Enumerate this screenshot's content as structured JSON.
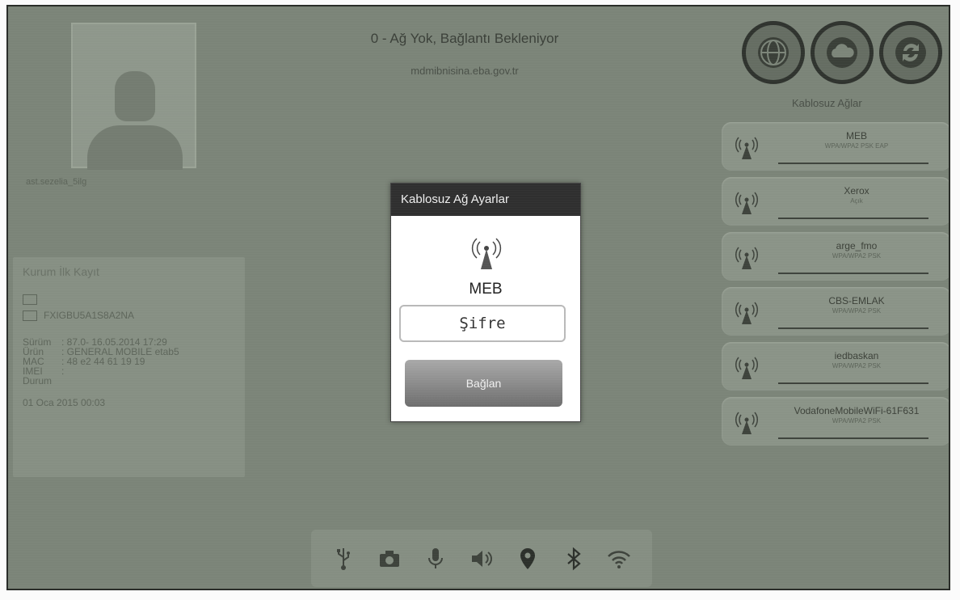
{
  "header": {
    "title": "0 - Ağ Yok, Bağlantı Bekleniyor",
    "subtitle": "mdmibnisina.eba.gov.tr"
  },
  "top_buttons": [
    {
      "icon": "globe-icon"
    },
    {
      "icon": "cloud-icon"
    },
    {
      "icon": "sync-icon"
    }
  ],
  "user": {
    "name": "ast.sezelia_5ilg"
  },
  "kurum_panel": {
    "title": "Kurum İlk Kayıt",
    "device_id": "FXIGBU5A1S8A2NA",
    "info": [
      {
        "key": "Sürüm",
        "value": ": 87.0- 16.05.2014 17:29"
      },
      {
        "key": "Ürün",
        "value": ": GENERAL MOBILE etab5"
      },
      {
        "key": "MAC",
        "value": ": 48 e2 44 61 19 19"
      },
      {
        "key": "IMEI",
        "value": ": "
      },
      {
        "key": "Durum",
        "value": ""
      }
    ],
    "date": "01 Oca 2015  00:03"
  },
  "wireless": {
    "label": "Kablosuz Ağlar",
    "networks": [
      {
        "name": "MEB",
        "security": "WPA/WPA2 PSK EAP"
      },
      {
        "name": "Xerox",
        "security": "Açık"
      },
      {
        "name": "arge_fmo",
        "security": "WPA/WPA2 PSK"
      },
      {
        "name": "CBS-EMLAK",
        "security": "WPA/WPA2 PSK"
      },
      {
        "name": "iedbaskan",
        "security": "WPA/WPA2 PSK"
      },
      {
        "name": "VodafoneMobileWiFi-61F631",
        "security": "WPA/WPA2 PSK"
      }
    ]
  },
  "dialog": {
    "title": "Kablosuz Ağ Ayarlar",
    "network_name": "MEB",
    "password_placeholder": "Şifre",
    "connect_label": "Bağlan"
  },
  "bottom_bar": [
    {
      "icon": "usb-icon"
    },
    {
      "icon": "camera-icon"
    },
    {
      "icon": "microphone-icon"
    },
    {
      "icon": "speaker-icon"
    },
    {
      "icon": "location-icon"
    },
    {
      "icon": "bluetooth-icon"
    },
    {
      "icon": "wifi-icon"
    }
  ],
  "colors": {
    "screen_bg": "#7b8478",
    "dialog_header": "#2f2f2f",
    "connect_button": "#8c8c8c"
  }
}
